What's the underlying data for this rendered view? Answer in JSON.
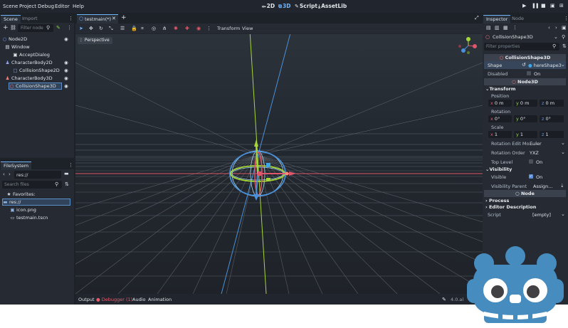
{
  "menu": [
    "Scene",
    "Project",
    "Debug",
    "Editor",
    "Help"
  ],
  "workspaces": [
    {
      "label": "2D",
      "icon": "⤠"
    },
    {
      "label": "3D",
      "icon": "⧉"
    },
    {
      "label": "Script",
      "icon": "✎"
    },
    {
      "label": "AssetLib",
      "icon": "⤓"
    }
  ],
  "scene_dock": {
    "tabs": [
      "Scene",
      "Import"
    ],
    "filter_placeholder": "Filter node",
    "nodes": [
      {
        "label": "Node2D",
        "icon": "○",
        "color": "#8da5f3"
      },
      {
        "label": "Window",
        "icon": "▤",
        "color": "#dfe3e8"
      },
      {
        "label": "AcceptDialog",
        "icon": "▣",
        "color": "#dfe3e8"
      },
      {
        "label": "CharacterBody2D",
        "icon": "♟",
        "color": "#8da5f3"
      },
      {
        "label": "CollisionShape2D",
        "icon": "□",
        "color": "#8da5f3"
      },
      {
        "label": "CharacterBody3D",
        "icon": "♟",
        "color": "#fc7f7f"
      },
      {
        "label": "CollisionShape3D",
        "icon": "○",
        "color": "#fc7f7f"
      }
    ]
  },
  "filesystem_dock": {
    "tab": "FileSystem",
    "path": "res://",
    "search_placeholder": "Search files",
    "favorites_label": "Favorites:",
    "items": [
      "res://",
      "icon.png",
      "testmain.tscn"
    ]
  },
  "editor_tab": {
    "label": "testmain(*)"
  },
  "viewport_toolbar": {
    "transform_menu": "Transform",
    "view_menu": "View"
  },
  "viewport": {
    "perspective_label": "Perspective"
  },
  "bottom_tabs": [
    "Output",
    "Debugger (1)",
    "Audio",
    "Animation"
  ],
  "version_label": "4.0.al",
  "inspector": {
    "tabs": [
      "Inspector",
      "Node"
    ],
    "object_name": "CollisionShape3D",
    "filter_placeholder": "Filter properties",
    "section_main": "CollisionShape3D",
    "shape_label": "Shape",
    "shape_value": "hereShape3",
    "disabled_label": "Disabled",
    "disabled_value": "On",
    "section_node3d": "Node3D",
    "transform_group": "Transform",
    "position_label": "Position",
    "position": {
      "x": "0",
      "y": "0",
      "z": "0",
      "unit": "m"
    },
    "rotation_label": "Rotation",
    "rotation": {
      "x": "0",
      "y": "0",
      "z": "0",
      "unit": "°"
    },
    "scale_label": "Scale",
    "scale": {
      "x": "1",
      "y": "1",
      "z": "1"
    },
    "rot_edit_label": "Rotation Edit Mo...",
    "rot_edit_value": "Euler",
    "rot_order_label": "Rotation Order",
    "rot_order_value": "YXZ",
    "top_level_label": "Top Level",
    "top_level_value": "On",
    "visibility_group": "Visibility",
    "visible_label": "Visible",
    "visible_value": "On",
    "vis_parent_label": "Visibility Parent",
    "vis_parent_value": "Assign...",
    "section_node": "Node",
    "process_group": "Process",
    "editor_desc_group": "Editor Description",
    "script_label": "Script",
    "script_value": "[empty]"
  },
  "colors": {
    "accent": "#6eb6ff",
    "axis_x": "#e85a6a",
    "axis_y": "#8bd34a",
    "axis_z": "#5d9ef0",
    "godot_blue": "#478cbf"
  }
}
